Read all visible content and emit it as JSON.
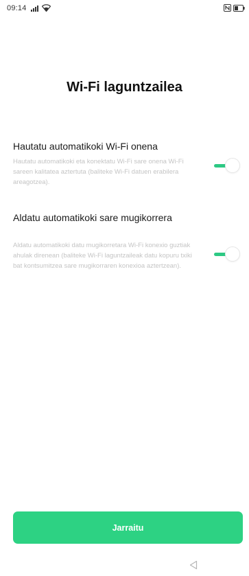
{
  "status_bar": {
    "time": "09:14",
    "icons": [
      "signal-icon",
      "wifi-icon",
      "nfc-icon",
      "battery-icon"
    ]
  },
  "title": "Wi-Fi laguntzailea",
  "settings": [
    {
      "title": "Hautatu automatikoki Wi-Fi onena",
      "description": "Hautatu automatikoki eta konektatu Wi-Fi sare onena Wi-Fi sareen kalitatea aztertuta (baliteke Wi-Fi datuen erabilera areagotzea).",
      "enabled": true
    },
    {
      "title": "Aldatu automatikoki sare mugikorrera",
      "description": "Aldatu automatikoki datu mugikorretara Wi-Fi konexio guztiak ahulak direnean (baliteke Wi-Fi laguntzaileak datu kopuru txiki bat kontsumitzea sare mugikorraren konexioa aztertzean).",
      "enabled": true
    }
  ],
  "continue_label": "Jarraitu",
  "colors": {
    "accent": "#2dd283",
    "toggle_on": "#2dc984",
    "description_text": "#c4c4c4"
  },
  "nav_icon": "back-triangle-icon"
}
